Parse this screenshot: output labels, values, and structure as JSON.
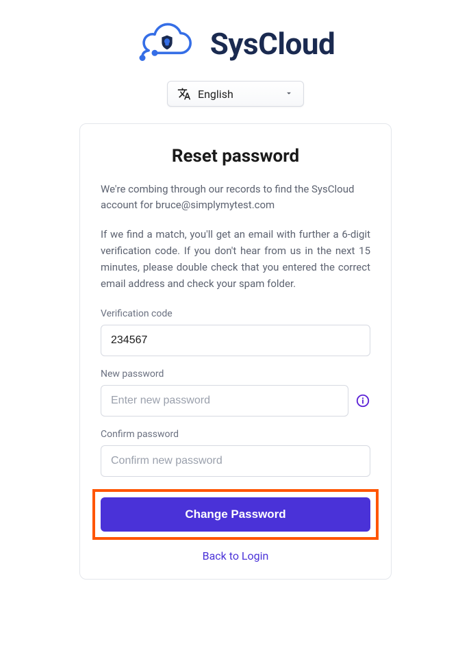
{
  "brand": {
    "name": "SysCloud"
  },
  "language": {
    "selected": "English"
  },
  "card": {
    "title": "Reset password",
    "desc_line1": "We're combing through our records to find the SysCloud account for bruce@simplymytest.com",
    "desc_line2": "If we find a match, you'll get an email with further a 6-digit verification code. If you don't hear from us in the next 15 minutes, please double check that you entered the correct email address and check your spam folder.",
    "verification": {
      "label": "Verification code",
      "value": "234567"
    },
    "new_password": {
      "label": "New password",
      "placeholder": "Enter new password"
    },
    "confirm_password": {
      "label": "Confirm password",
      "placeholder": "Confirm new password"
    },
    "submit_label": "Change Password",
    "back_link": "Back to Login"
  }
}
